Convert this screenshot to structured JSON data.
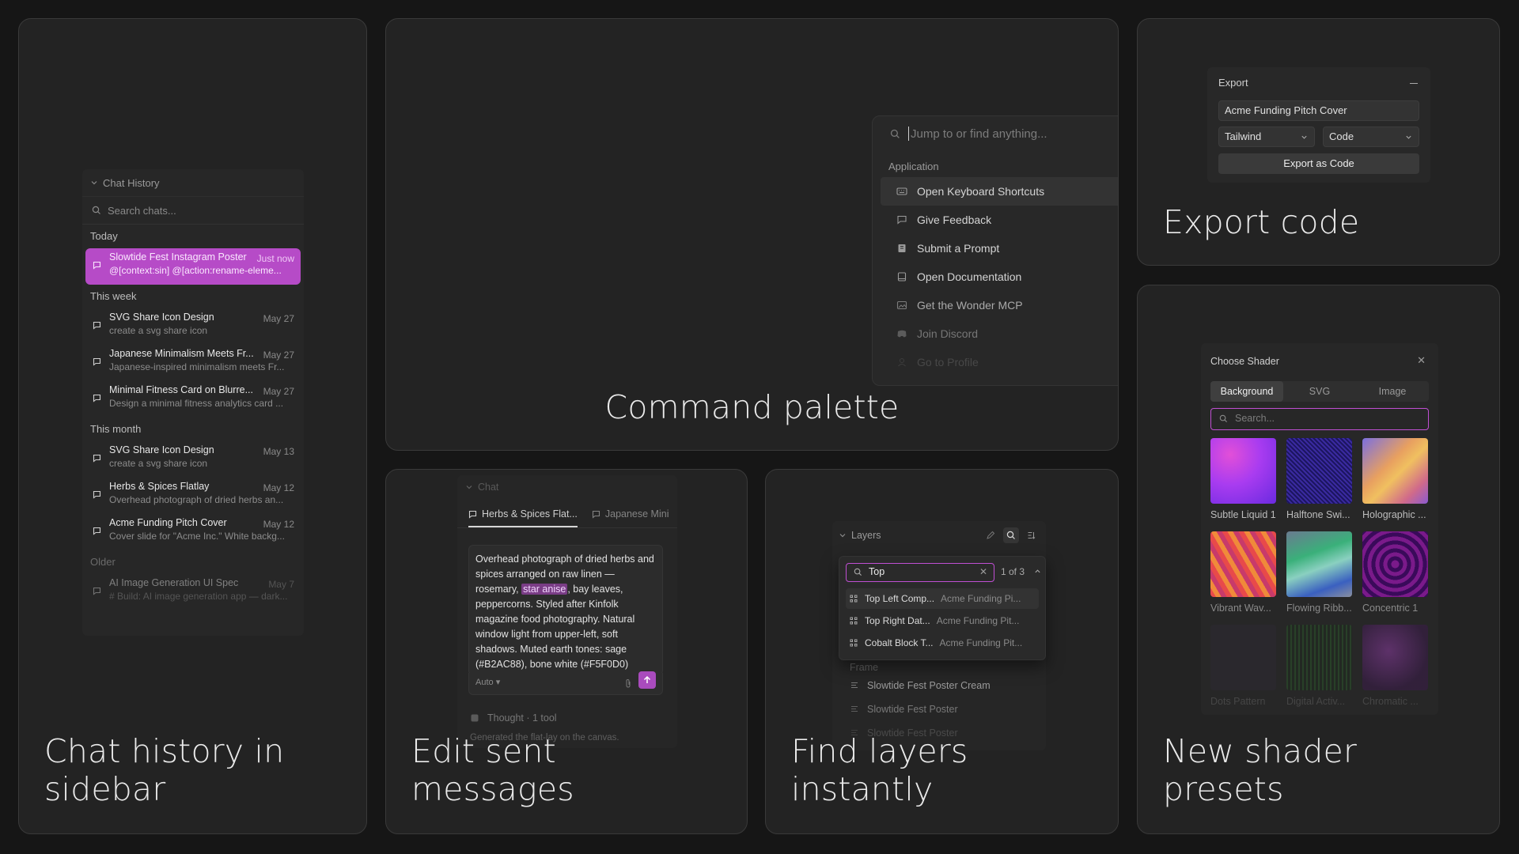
{
  "cards": {
    "chat_history_caption": "Chat history in sidebar",
    "command_palette_caption": "Command palette",
    "export_caption": "Export code",
    "edit_caption": "Edit sent messages",
    "layers_caption": "Find layers instantly",
    "shader_caption": "New shader presets"
  },
  "chat_history": {
    "header": "Chat History",
    "search_placeholder": "Search chats...",
    "groups": {
      "today": "Today",
      "this_week": "This week",
      "this_month": "This month",
      "older": "Older"
    },
    "items": [
      {
        "title": "Slowtide Fest Instagram Poster",
        "date": "Just now",
        "snippet": "@[context:sin] @[action:rename-eleme..."
      },
      {
        "title": "SVG Share Icon Design",
        "date": "May 27",
        "snippet": "create a svg share icon"
      },
      {
        "title": "Japanese Minimalism Meets Fr...",
        "date": "May 27",
        "snippet": "Japanese-inspired minimalism meets Fr..."
      },
      {
        "title": "Minimal Fitness Card on Blurre...",
        "date": "May 27",
        "snippet": "Design a minimal fitness analytics card ..."
      },
      {
        "title": "SVG Share Icon Design",
        "date": "May 13",
        "snippet": "create a svg share icon"
      },
      {
        "title": "Herbs & Spices Flatlay",
        "date": "May 12",
        "snippet": "Overhead photograph of dried herbs an..."
      },
      {
        "title": "Acme Funding Pitch Cover",
        "date": "May 12",
        "snippet": "Cover slide for \"Acme Inc.\" White backg..."
      },
      {
        "title": "AI Image Generation UI Spec",
        "date": "May 7",
        "snippet": "# Build: AI image generation app — dark..."
      }
    ]
  },
  "command_palette": {
    "placeholder": "Jump to or find anything...",
    "section": "Application",
    "items": [
      "Open Keyboard Shortcuts",
      "Give Feedback",
      "Submit a Prompt",
      "Open Documentation",
      "Get the Wonder MCP",
      "Join Discord",
      "Go to Profile"
    ]
  },
  "export": {
    "title": "Export",
    "name_value": "Acme Funding Pitch Cover",
    "framework": "Tailwind",
    "format": "Code",
    "button": "Export as Code"
  },
  "edit_messages": {
    "header": "Chat",
    "tabs": [
      "Herbs & Spices Flat...",
      "Japanese Mini"
    ],
    "message_before": "Overhead photograph of dried herbs and spices arranged on raw linen — rosemary, ",
    "message_highlight": "star anise",
    "message_after": ", bay leaves, peppercorns. Styled after Kinfolk magazine food photography. Natural window light from upper-left, soft shadows. Muted earth tones: sage (#B2AC88), bone white (#F5F0D0)",
    "mode": "Auto",
    "thought": "Thought · 1 tool",
    "generated": "Generated the flat-lay on the canvas."
  },
  "layers": {
    "header": "Layers",
    "search_value": "Top",
    "count": "1 of 3",
    "results": [
      {
        "name": "Top Left Comp...",
        "parent": "Acme Funding Pi..."
      },
      {
        "name": "Top Right Dat...",
        "parent": "Acme Funding Pit..."
      },
      {
        "name": "Cobalt Block T...",
        "parent": "Acme Funding Pit..."
      }
    ],
    "rows": [
      "Frame",
      "Slowtide Fest Poster Cream",
      "Slowtide Fest Poster",
      "Slowtide Fest Poster"
    ]
  },
  "shader": {
    "title": "Choose Shader",
    "tabs": [
      "Background",
      "SVG",
      "Image"
    ],
    "search_placeholder": "Search...",
    "presets": [
      "Subtle Liquid 1",
      "Halftone Swi...",
      "Holographic ...",
      "Vibrant Wav...",
      "Flowing Ribb...",
      "Concentric 1",
      "Dots Pattern",
      "Digital Activ...",
      "Chromatic ..."
    ]
  }
}
